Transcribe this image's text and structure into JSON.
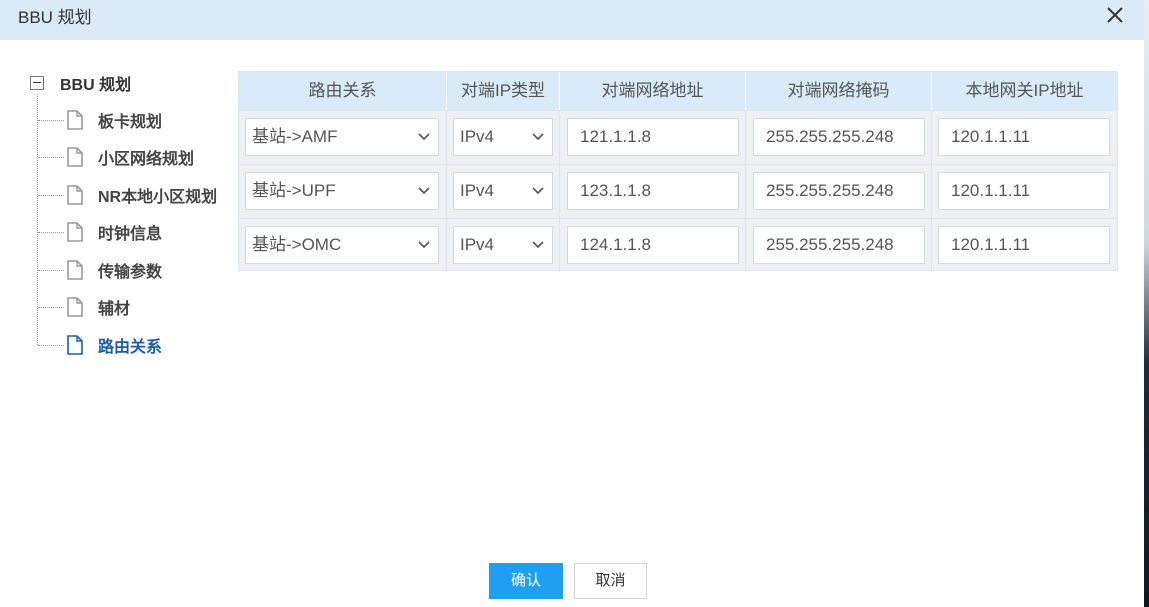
{
  "dialog": {
    "title": "BBU 规划",
    "close_icon": "close-icon"
  },
  "tree": {
    "root_label": "BBU 规划",
    "items": [
      {
        "label": "板卡规划",
        "active": false
      },
      {
        "label": "小区网络规划",
        "active": false
      },
      {
        "label": "NR本地小区规划",
        "active": false
      },
      {
        "label": "时钟信息",
        "active": false
      },
      {
        "label": "传输参数",
        "active": false
      },
      {
        "label": "辅材",
        "active": false
      },
      {
        "label": "路由关系",
        "active": true
      }
    ]
  },
  "table": {
    "headers": [
      "路由关系",
      "对端IP类型",
      "对端网络地址",
      "对端网络掩码",
      "本地网关IP地址"
    ],
    "rows": [
      {
        "route": "基站->AMF",
        "ip_type": "IPv4",
        "peer_addr": "121.1.1.8",
        "peer_mask": "255.255.255.248",
        "gateway": "120.1.1.11"
      },
      {
        "route": "基站->UPF",
        "ip_type": "IPv4",
        "peer_addr": "123.1.1.8",
        "peer_mask": "255.255.255.248",
        "gateway": "120.1.1.11"
      },
      {
        "route": "基站->OMC",
        "ip_type": "IPv4",
        "peer_addr": "124.1.1.8",
        "peer_mask": "255.255.255.248",
        "gateway": "120.1.1.11"
      }
    ]
  },
  "buttons": {
    "confirm": "确认",
    "cancel": "取消"
  },
  "colors": {
    "titlebar": "#dbeaf7",
    "header": "#d9eaf8",
    "primary": "#1e9ff2",
    "active_link": "#1b5da6"
  }
}
